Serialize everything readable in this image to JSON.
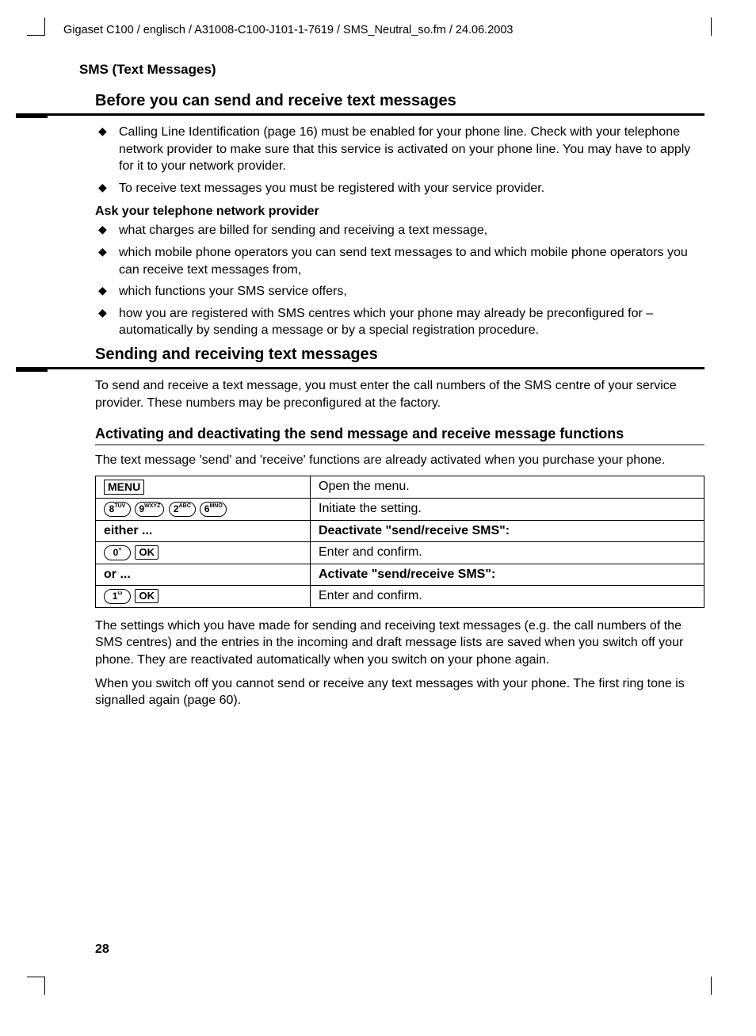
{
  "header": "Gigaset C100 / englisch / A31008-C100-J101-1-7619 / SMS_Neutral_so.fm / 24.06.2003",
  "sectionLabel": "SMS (Text Messages)",
  "h2_1": "Before you can send and receive text messages",
  "bullets1": [
    "Calling Line Identification (page 16) must be enabled for your phone line. Check with your telephone network provider to make sure that this service is activated on your phone line. You may have to apply for it to your network provider.",
    "To receive text messages you must be registered with your service provider."
  ],
  "boldSub1": "Ask your telephone network provider",
  "bullets2": [
    "what charges are billed for sending and receiving a text message,",
    "which mobile phone operators you can send text messages to and which mobile phone operators you can receive text messages from,",
    "which functions your SMS service offers,",
    "how you are registered with SMS centres which your phone may already be preconfigured for – automatically by sending a message or by a special registration procedure."
  ],
  "h2_2": "Sending and receiving text messages",
  "para1": "To send and receive a text message, you must enter the call numbers of the SMS centre of your service provider. These numbers may be preconfigured at the factory.",
  "h3_1": "Activating and deactivating the send message and receive message functions",
  "para2": "The text message 'send' and 'receive' functions are already activated when you purchase your phone.",
  "table": {
    "row1": {
      "right": "Open the menu."
    },
    "keys8926": {
      "k1": {
        "d": "8",
        "l": "TUV"
      },
      "k2": {
        "d": "9",
        "l": "WXYZ"
      },
      "k3": {
        "d": "2",
        "l": "ABC"
      },
      "k4": {
        "d": "6",
        "l": "MNO"
      }
    },
    "row2": {
      "right": "Initiate the setting."
    },
    "row3": {
      "left": "either ...",
      "right": "Deactivate \"send/receive SMS\":"
    },
    "key0": {
      "d": "0",
      "l": "+"
    },
    "row4": {
      "right": "Enter and confirm."
    },
    "row5": {
      "left": "or ...",
      "right": "Activate \"send/receive SMS\":"
    },
    "key1": {
      "d": "1",
      "l": "ω"
    },
    "row6": {
      "right": "Enter and confirm."
    }
  },
  "para3": "The settings which you have made for sending and receiving text messages (e.g. the call numbers of the SMS centres) and the entries in the incoming and draft message lists are saved when you switch off your phone. They are reactivated automatically when you switch on your phone again.",
  "para4": "When you switch off you cannot send or receive any text messages with your phone. The first ring tone is signalled again (page 60).",
  "pageNum": "28",
  "labels": {
    "menu": "MENU",
    "ok": "OK"
  }
}
